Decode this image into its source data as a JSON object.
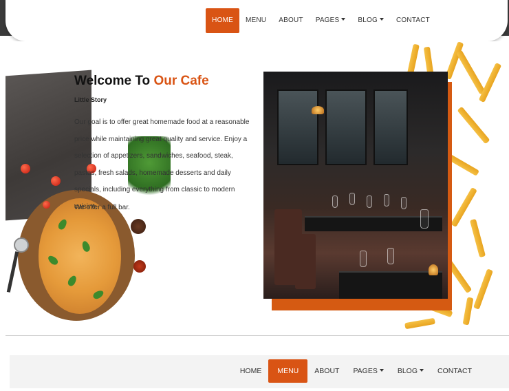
{
  "nav_top": {
    "items": [
      {
        "label": "HOME",
        "active": true
      },
      {
        "label": "MENU",
        "active": false
      },
      {
        "label": "ABOUT",
        "active": false
      },
      {
        "label": "PAGES",
        "active": false,
        "dropdown": true
      },
      {
        "label": "BLOG",
        "active": false,
        "dropdown": true
      },
      {
        "label": "CONTACT",
        "active": false
      }
    ]
  },
  "hero": {
    "title_prefix": "Welcome To ",
    "title_accent": "Our Cafe",
    "subtitle": "Little Story",
    "paragraph": "Our goal is to offer great homemade food at a reasonable price while maintaining great quality and service. Enjoy a selection of appetizers, sandwiches, seafood, steak, pastas, fresh salads, homemade desserts and daily specials, including everything from classic to modern cuisine.",
    "paragraph2": "We offer a full bar."
  },
  "nav_bottom": {
    "items": [
      {
        "label": "HOME",
        "active": false
      },
      {
        "label": "MENU",
        "active": true
      },
      {
        "label": "ABOUT",
        "active": false
      },
      {
        "label": "PAGES",
        "active": false,
        "dropdown": true
      },
      {
        "label": "BLOG",
        "active": false,
        "dropdown": true
      },
      {
        "label": "CONTACT",
        "active": false
      }
    ]
  },
  "colors": {
    "accent": "#d95414",
    "nav_bg_dark": "#3a3a3a",
    "nav_bottom_bg": "#f3f3f3"
  }
}
